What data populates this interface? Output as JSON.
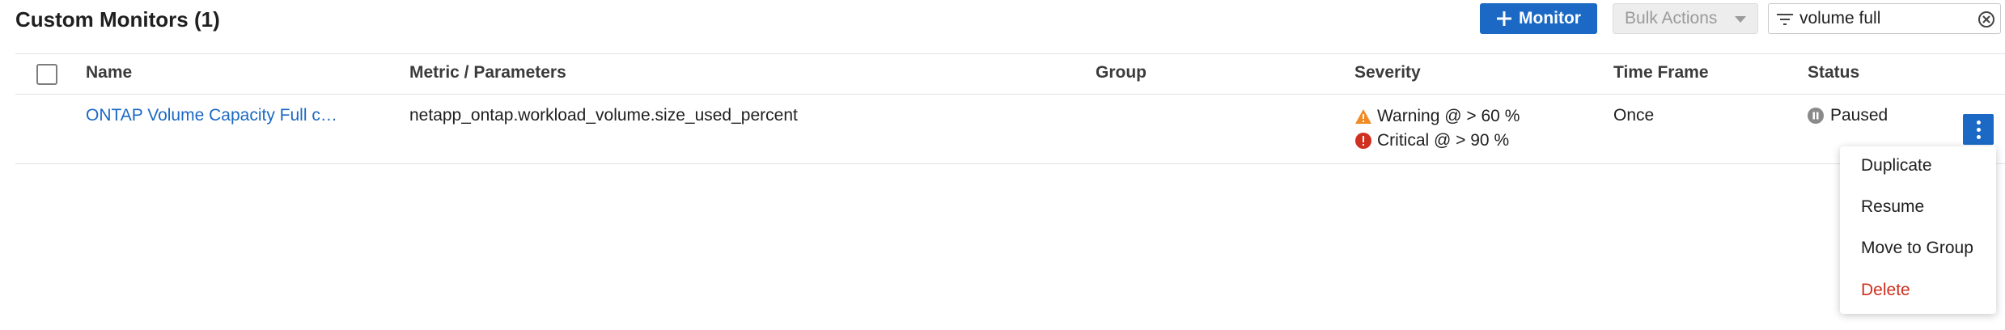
{
  "header": {
    "title": "Custom Monitors (1)",
    "add_monitor_label": "Monitor",
    "bulk_actions_label": "Bulk Actions"
  },
  "filter": {
    "value": "volume full",
    "icon": "filter-icon",
    "clear_icon": "clear-circle-icon"
  },
  "table": {
    "columns": [
      "Name",
      "Metric / Parameters",
      "Group",
      "Severity",
      "Time Frame",
      "Status"
    ],
    "rows": [
      {
        "name": "ONTAP Volume Capacity Full c…",
        "metric": "netapp_ontap.workload_volume.size_used_percent",
        "group": "",
        "severity": {
          "warning": "Warning @ > 60 %",
          "critical": "Critical @ > 90 %"
        },
        "time_frame": "Once",
        "status": "Paused"
      }
    ]
  },
  "row_menu": {
    "items": [
      "Duplicate",
      "Resume",
      "Move to Group",
      "Delete"
    ]
  },
  "colors": {
    "accent": "#1b69c4",
    "warning": "#f08a24",
    "critical": "#d0301f",
    "paused": "#8a8a8a"
  }
}
